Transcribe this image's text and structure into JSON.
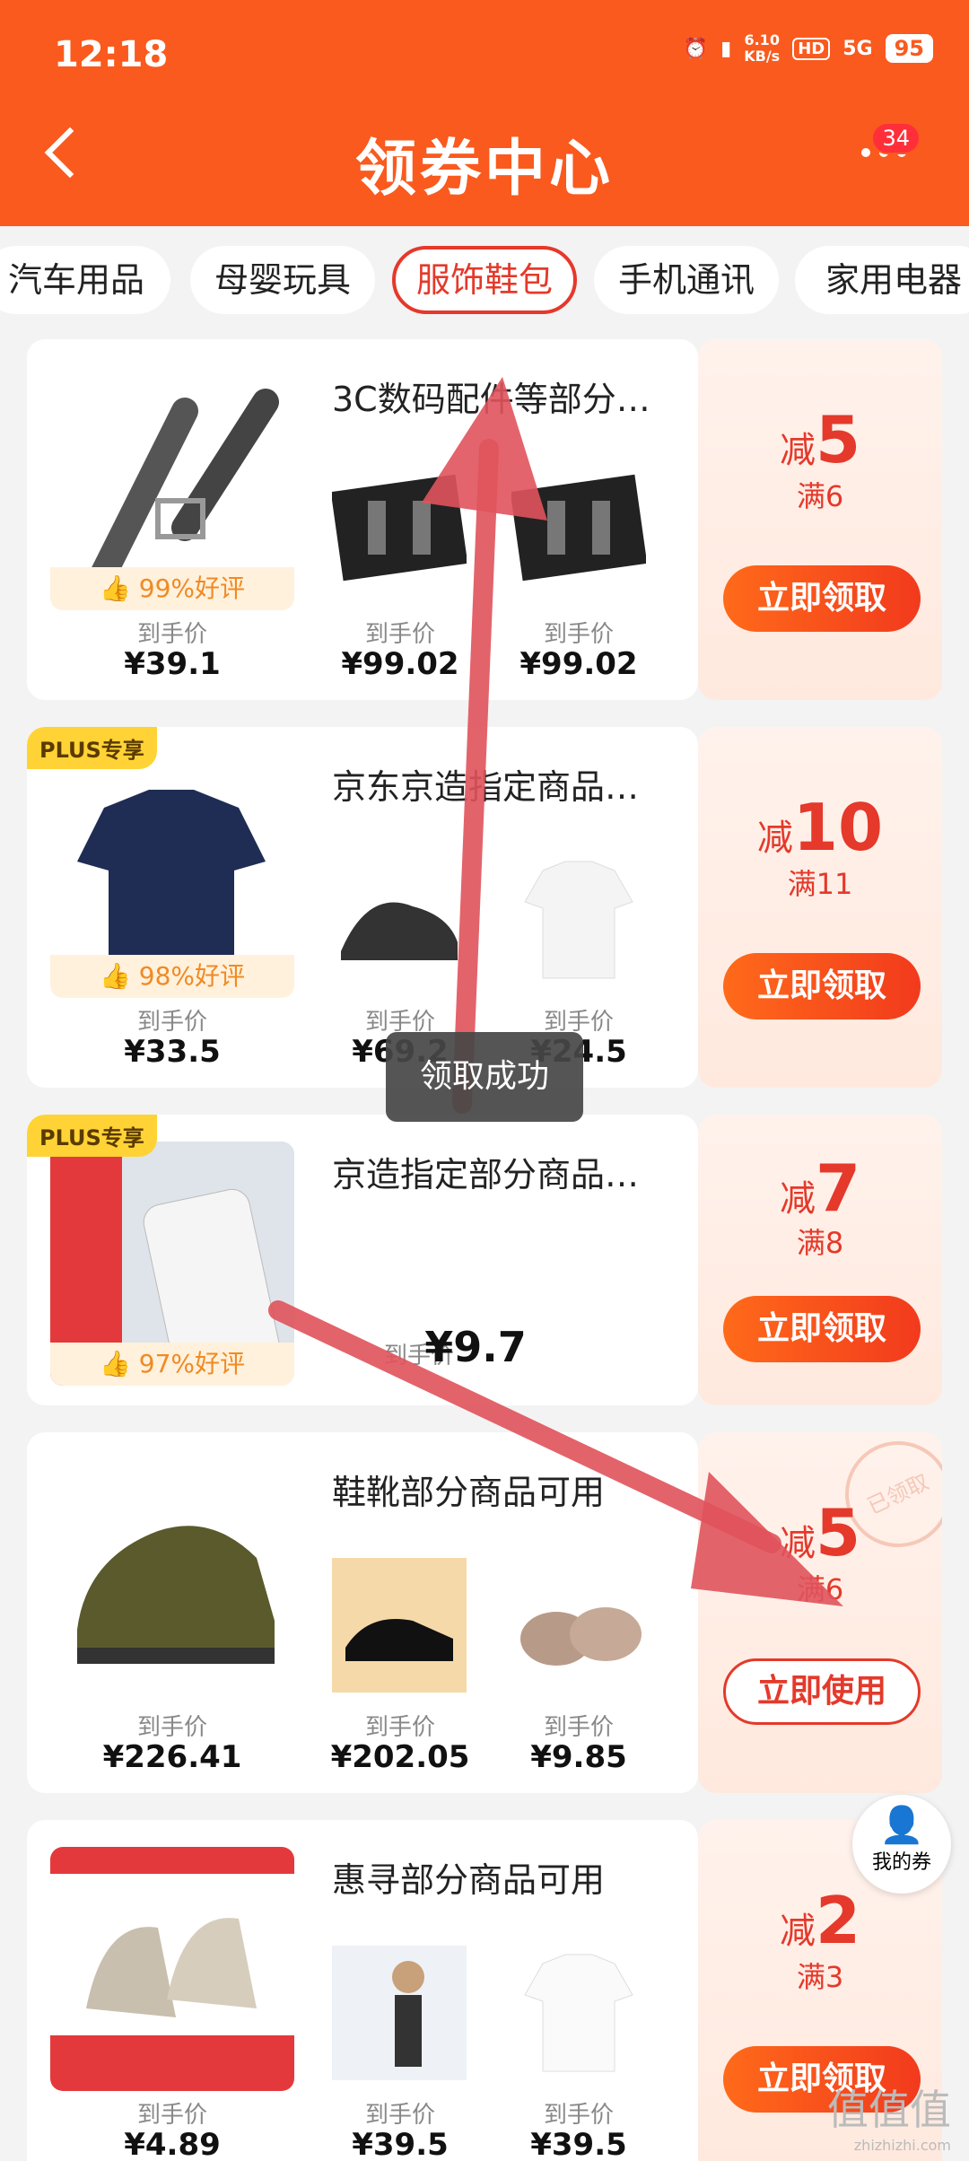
{
  "status": {
    "time": "12:18",
    "speed_top": "6.10",
    "speed_bottom": "KB/s",
    "hd": "HD",
    "net": "5G",
    "battery": "95"
  },
  "header": {
    "title": "领券中心",
    "more_badge": "34"
  },
  "tabs": [
    "汽车用品",
    "母婴玩具",
    "服饰鞋包",
    "手机通讯",
    "家用电器"
  ],
  "cards": [
    {
      "title": "3C数码配件等部分…",
      "rating": "99%好评",
      "price_label": "到手价",
      "prices": [
        "¥39.1",
        "¥99.02",
        "¥99.02"
      ],
      "coupon": {
        "jian": "减",
        "amount": "5",
        "threshold": "满6",
        "button": "立即领取"
      }
    },
    {
      "plus": "PLUS专享",
      "title": "京东京造指定商品…",
      "rating": "98%好评",
      "price_label": "到手价",
      "prices": [
        "¥33.5",
        "¥69.2",
        "¥24.5"
      ],
      "coupon": {
        "jian": "减",
        "amount": "10",
        "threshold": "满11",
        "button": "立即领取"
      }
    },
    {
      "plus": "PLUS专享",
      "title": "京造指定部分商品…",
      "rating": "97%好评",
      "price_label": "到手价",
      "single_price": "¥9.7",
      "coupon": {
        "jian": "减",
        "amount": "7",
        "threshold": "满8",
        "button": "立即领取"
      }
    },
    {
      "title": "鞋靴部分商品可用",
      "price_label": "到手价",
      "prices": [
        "¥226.41",
        "¥202.05",
        "¥9.85"
      ],
      "stamp": "已领取",
      "coupon": {
        "jian": "减",
        "amount": "5",
        "threshold": "满6",
        "button": "立即使用"
      }
    },
    {
      "title": "惠寻部分商品可用",
      "price_label": "到手价",
      "prices": [
        "¥4.89",
        "¥39.5",
        "¥39.5"
      ],
      "coupon": {
        "jian": "减",
        "amount": "2",
        "threshold": "满3",
        "button": "立即领取"
      }
    }
  ],
  "toast": "领取成功",
  "my_coupon": "我的券",
  "watermark": {
    "main": "值值值",
    "sub": "zhizhizhi.com"
  },
  "colors": {
    "header": "#fa5a1e",
    "accent": "#e4392b"
  }
}
